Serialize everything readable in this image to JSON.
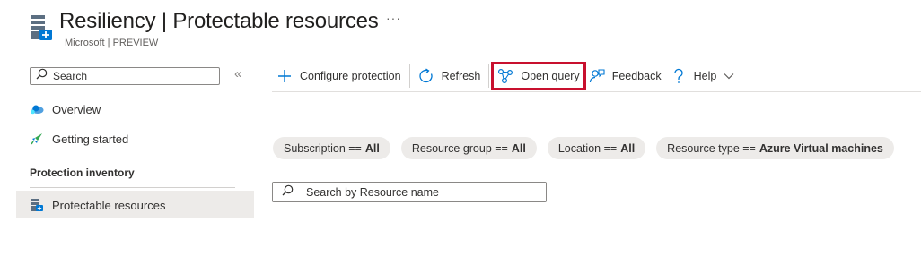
{
  "header": {
    "title": "Resiliency | Protectable resources",
    "subtitle": "Microsoft | PREVIEW",
    "more_label": "···",
    "icon": "resiliency-server-icon"
  },
  "sidebar": {
    "search_placeholder": "Search",
    "collapse_label": "«",
    "items": [
      {
        "label": "Overview",
        "icon": "cloud-overview-icon"
      },
      {
        "label": "Getting started",
        "icon": "rocket-icon"
      }
    ],
    "section": "Protection inventory",
    "section_items": [
      {
        "label": "Protectable resources",
        "icon": "protectable-server-icon",
        "selected": true
      }
    ]
  },
  "toolbar": {
    "configure_label": "Configure protection",
    "refresh_label": "Refresh",
    "open_query_label": "Open query",
    "feedback_label": "Feedback",
    "help_label": "Help"
  },
  "filters": [
    {
      "key": "Subscription ==",
      "value": "All"
    },
    {
      "key": "Resource group ==",
      "value": "All"
    },
    {
      "key": "Location ==",
      "value": "All"
    },
    {
      "key": "Resource type ==",
      "value": "Azure Virtual machines"
    }
  ],
  "resource_search": {
    "placeholder": "Search by Resource name"
  },
  "colors": {
    "accent": "#0078d4",
    "highlight_border": "#c8102e",
    "selected_bg": "#edebe9"
  }
}
